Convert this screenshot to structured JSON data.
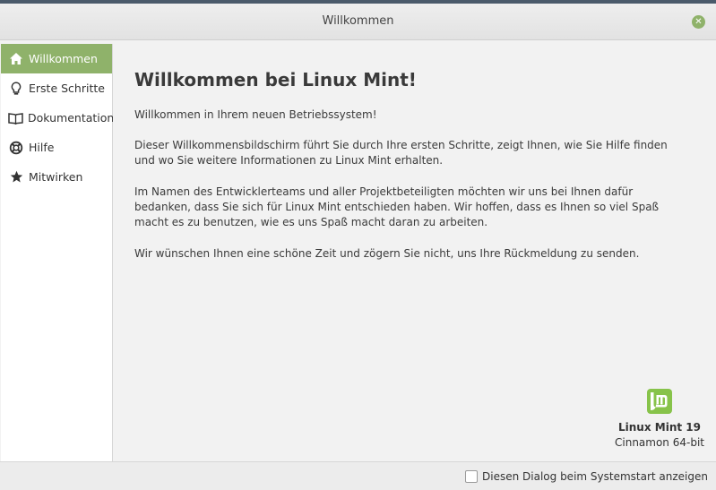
{
  "window": {
    "title": "Willkommen"
  },
  "sidebar": {
    "items": [
      {
        "label": "Willkommen",
        "icon": "home-icon",
        "active": true
      },
      {
        "label": "Erste Schritte",
        "icon": "lightbulb-icon",
        "active": false
      },
      {
        "label": "Dokumentation",
        "icon": "book-icon",
        "active": false
      },
      {
        "label": "Hilfe",
        "icon": "lifebuoy-icon",
        "active": false
      },
      {
        "label": "Mitwirken",
        "icon": "star-icon",
        "active": false
      }
    ]
  },
  "main": {
    "heading": "Willkommen bei Linux Mint!",
    "paragraphs": [
      "Willkommen in Ihrem neuen Betriebssystem!",
      "Dieser Willkommensbildschirm führt Sie durch Ihre ersten Schritte, zeigt Ihnen, wie Sie Hilfe finden und wo Sie weitere Informationen zu Linux Mint erhalten.",
      "Im Namen des Entwicklerteams und aller Projektbeteiligten möchten wir uns bei Ihnen dafür bedanken, dass Sie sich für Linux Mint entschieden haben. Wir hoffen, dass es Ihnen so viel Spaß macht es zu benutzen, wie es uns Spaß macht daran zu arbeiten.",
      "Wir wünschen Ihnen eine schöne Zeit und zögern Sie nicht, uns Ihre Rückmeldung zu senden."
    ],
    "version": "Linux Mint 19",
    "edition": "Cinnamon 64-bit"
  },
  "footer": {
    "checkbox_label": "Diesen Dialog beim Systemstart anzeigen",
    "checkbox_checked": false
  },
  "colors": {
    "accent": "#8fb26a",
    "mint_logo": "#87c34a"
  }
}
